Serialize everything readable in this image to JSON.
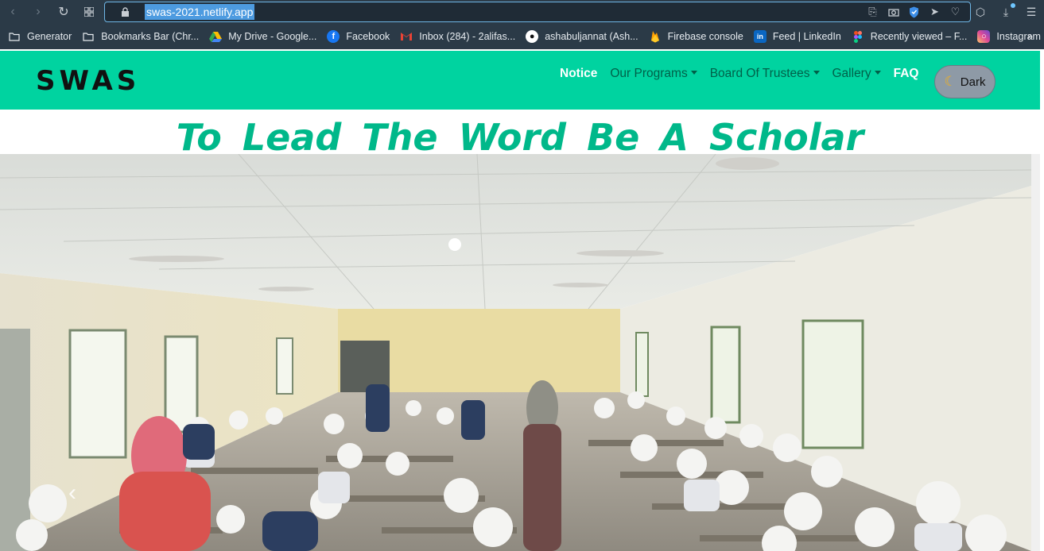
{
  "browser": {
    "url": "swas-2021.netlify.app",
    "icons": [
      "back-icon",
      "forward-icon",
      "reload-icon",
      "grid-icon",
      "lock-icon",
      "share-icon",
      "camera-icon",
      "shield-icon",
      "send-icon",
      "heart-icon",
      "box-icon",
      "download-icon",
      "menu-icon"
    ]
  },
  "bookmarks": [
    {
      "label": "Generator",
      "icon": "folder-icon"
    },
    {
      "label": "Bookmarks Bar (Chr...",
      "icon": "folder-icon"
    },
    {
      "label": "My Drive - Google...",
      "icon": "drive-icon"
    },
    {
      "label": "Facebook",
      "icon": "facebook-icon"
    },
    {
      "label": "Inbox (284) - 2alifas...",
      "icon": "gmail-icon"
    },
    {
      "label": "ashabuljannat (Ash...",
      "icon": "github-icon"
    },
    {
      "label": "Firebase console",
      "icon": "firebase-icon"
    },
    {
      "label": "Feed | LinkedIn",
      "icon": "linkedin-icon"
    },
    {
      "label": "Recently viewed – F...",
      "icon": "figma-icon"
    },
    {
      "label": "Instagram",
      "icon": "instagram-icon"
    }
  ],
  "bookmarks_more": "»",
  "site": {
    "brand": "SWAS",
    "nav": [
      {
        "label": "Notice",
        "active": true,
        "dropdown": false
      },
      {
        "label": "Our Programs",
        "active": false,
        "dropdown": true
      },
      {
        "label": "Board Of Trustees",
        "active": false,
        "dropdown": true
      },
      {
        "label": "Gallery",
        "active": false,
        "dropdown": true
      },
      {
        "label": "FAQ",
        "active": true,
        "dropdown": false
      }
    ],
    "dark_toggle": "Dark",
    "tagline": "To Lead The Word Be A Scholar",
    "colors": {
      "navbar": "#00d3a0",
      "tagline": "#00b88a"
    }
  }
}
